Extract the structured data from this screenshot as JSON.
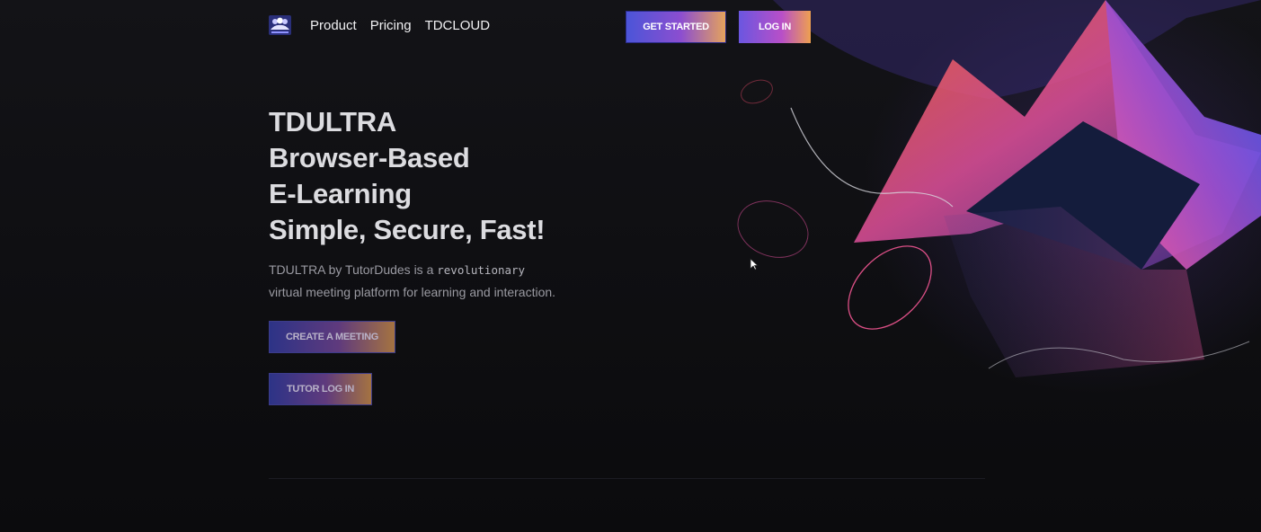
{
  "nav": {
    "logo_alt": "TDULTRA",
    "links": [
      {
        "label": "Product"
      },
      {
        "label": "Pricing"
      },
      {
        "label": "TDCLOUD"
      }
    ],
    "get_started_label": "GET STARTED",
    "login_label": "LOG IN"
  },
  "hero": {
    "title_lines": [
      "TDULTRA",
      "Browser-Based",
      "E-Learning",
      "Simple, Secure, Fast!"
    ],
    "desc_before": "TDULTRA by TutorDudes is a ",
    "desc_mono": "revolutionary",
    "desc_after": "virtual meeting platform for learning and interaction.",
    "create_meeting_label": "CREATE A MEETING",
    "tutor_login_label": "TUTOR LOG IN"
  },
  "colors": {
    "background": "#0f0f12",
    "accent_blue": "#4a55d8",
    "accent_pink": "#e0509a",
    "accent_orange": "#e6a45a"
  }
}
